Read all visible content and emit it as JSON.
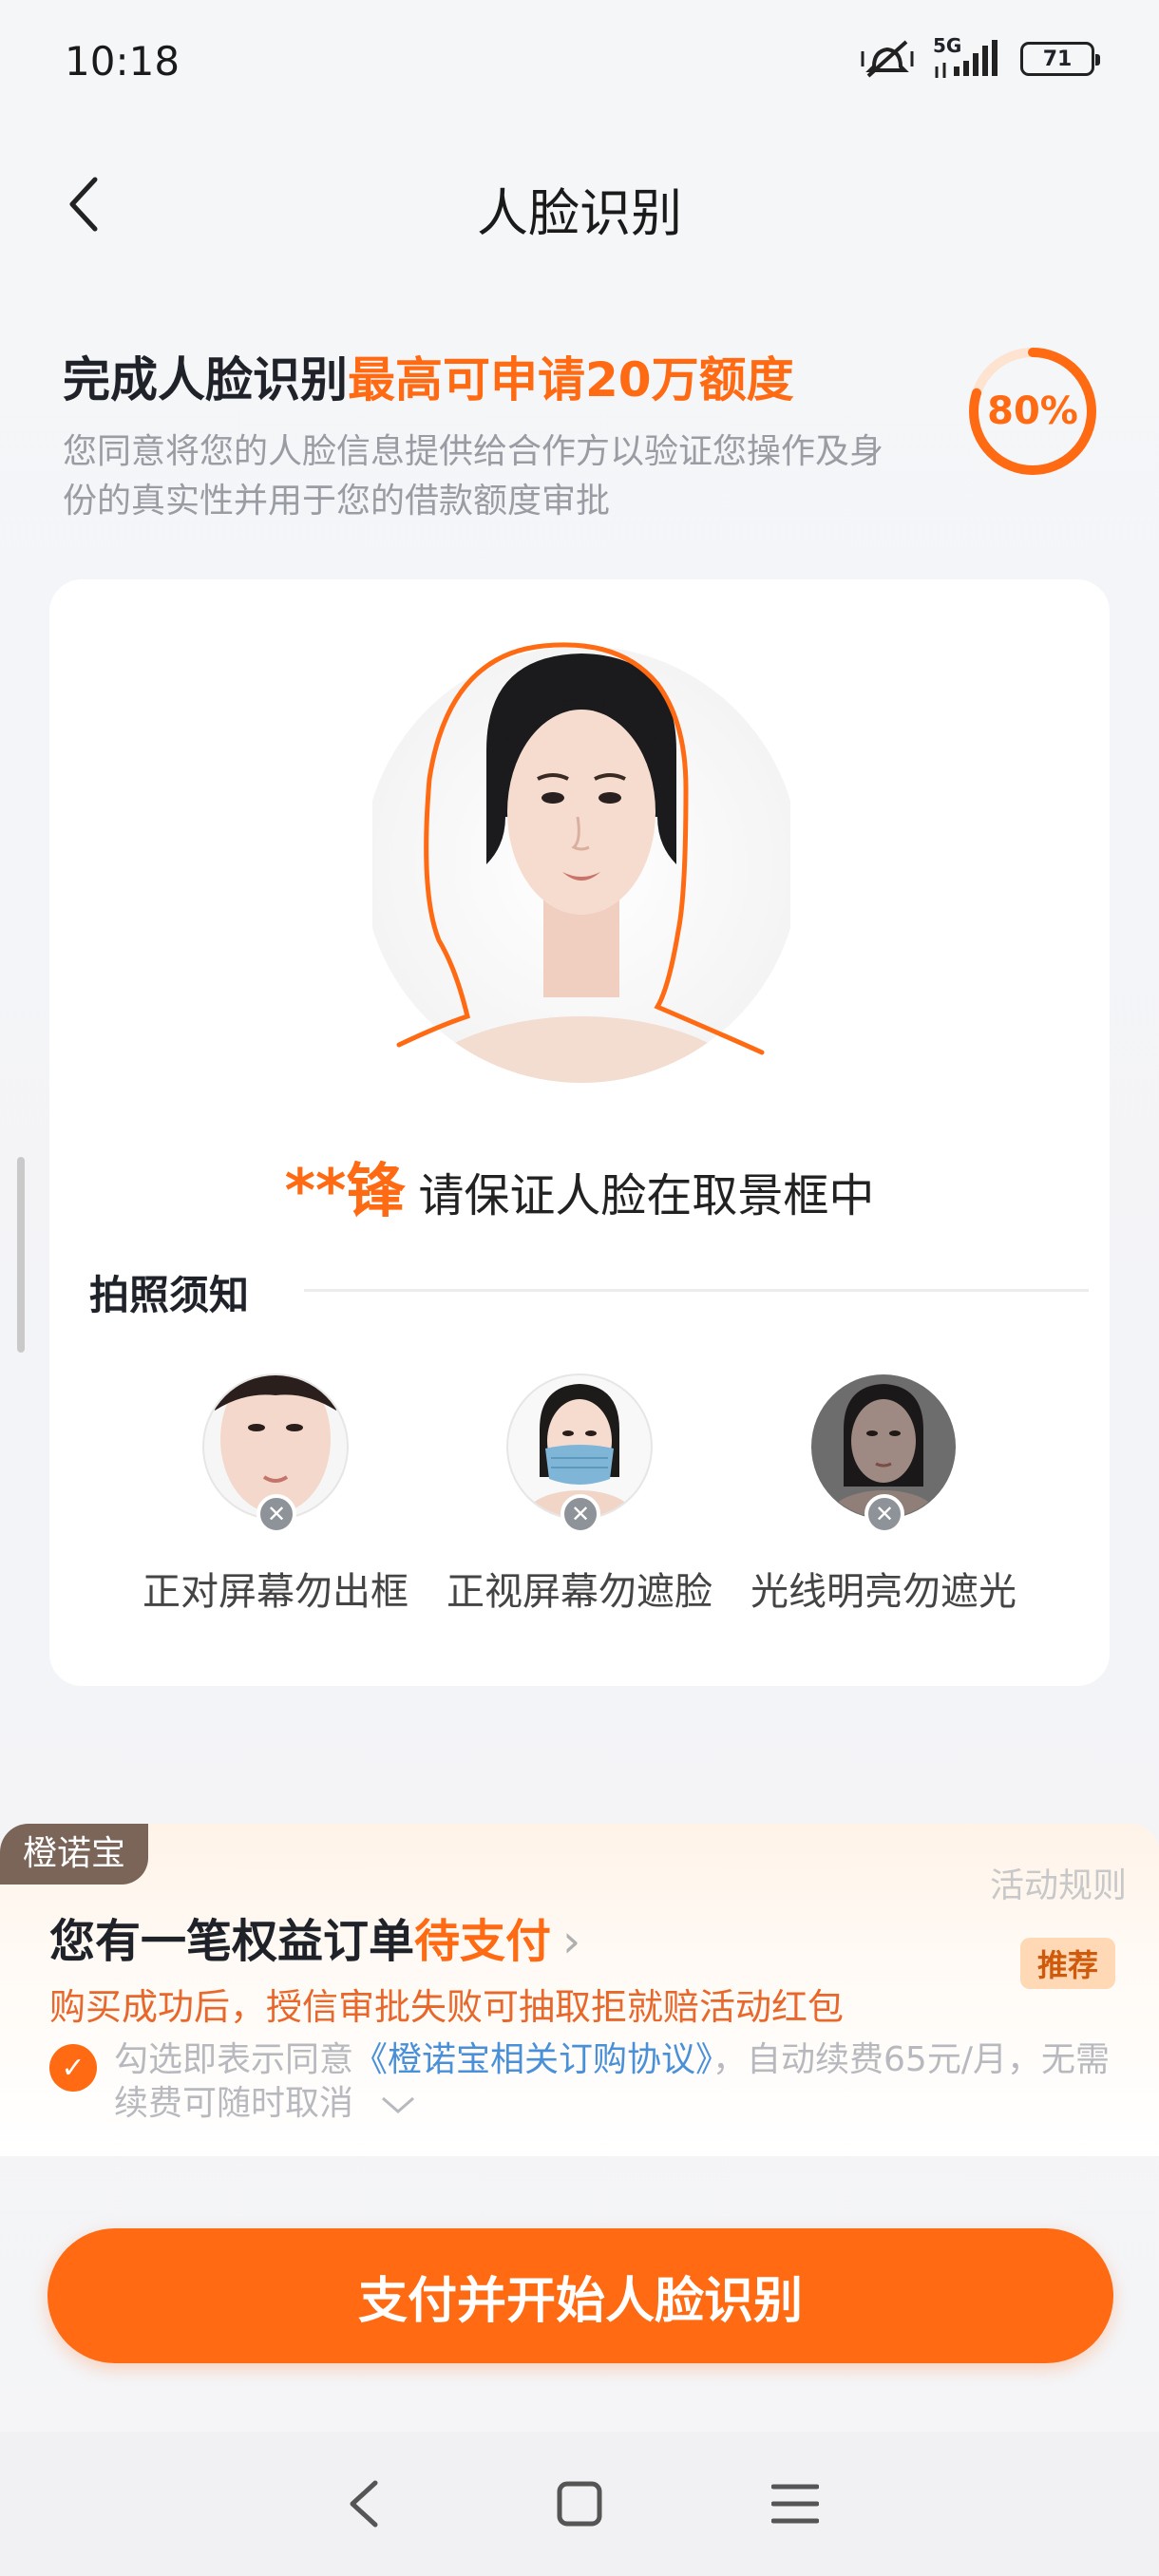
{
  "status_bar": {
    "time": "10:18",
    "network": "5G",
    "battery": "71"
  },
  "nav": {
    "title": "人脸识别"
  },
  "intro": {
    "title_prefix": "完成人脸识别",
    "title_highlight": "最高可申请20万额度",
    "subtitle": "您同意将您的人脸信息提供给合作方以验证您操作及身份的真实性并用于您的借款额度审批",
    "progress": 80,
    "progress_label": "80%"
  },
  "card": {
    "name_masked": "**锋",
    "instruction": "请保证人脸在取景框中",
    "tips_title": "拍照须知",
    "tips": [
      {
        "label": "正对屏幕勿出框",
        "icon": "face-out-of-frame"
      },
      {
        "label": "正视屏幕勿遮脸",
        "icon": "face-with-mask"
      },
      {
        "label": "光线明亮勿遮光",
        "icon": "face-dark-lighting"
      }
    ]
  },
  "promo": {
    "tag": "橙诺宝",
    "rules_link": "活动规则",
    "title_prefix": "您有一笔权益订单",
    "title_highlight": "待支付",
    "badge": "推荐",
    "description": "购买成功后，授信审批失败可抽取拒就赔活动红包",
    "agree_prefix": "勾选即表示同意",
    "agree_link": "《橙诺宝相关订购协议》",
    "agree_suffix": "，自动续费65元/月，无需续费可随时取消",
    "agreed": true
  },
  "pay_button": {
    "label": "支付并开始人脸识别"
  },
  "colors": {
    "accent": "#ff6a13",
    "link": "#4a90d9",
    "tag_bg": "#7a6558"
  }
}
